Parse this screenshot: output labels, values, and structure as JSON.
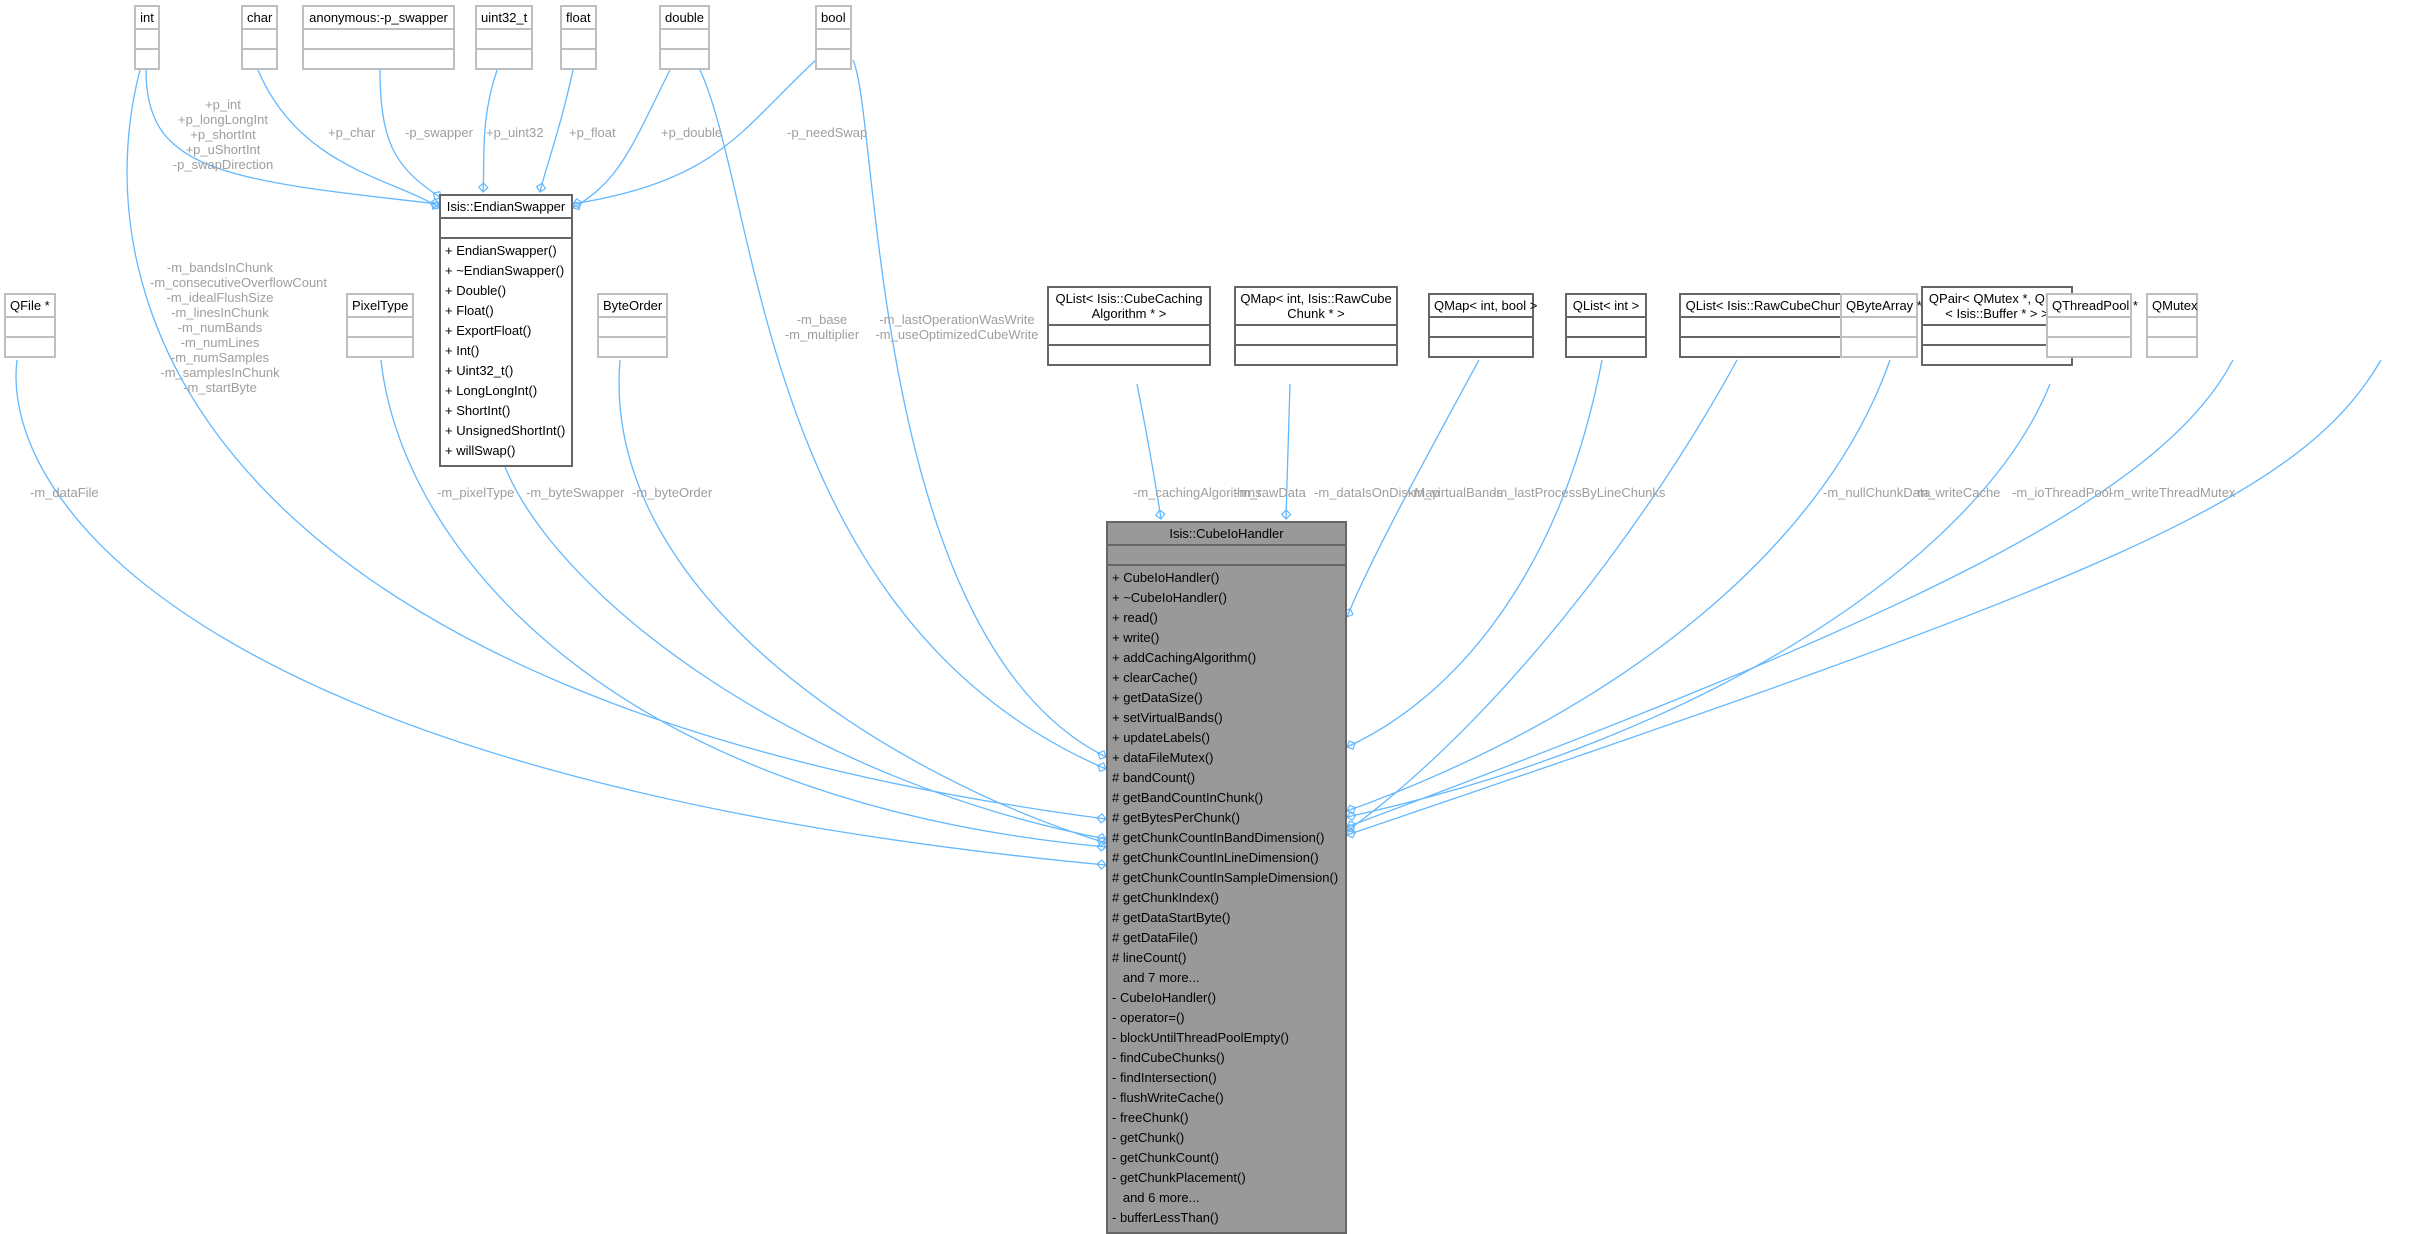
{
  "diagram": {
    "type": "collaboration-diagram",
    "main_class": {
      "name": "Isis::CubeIoHandler",
      "members": [
        "+ CubeIoHandler()",
        "+ ~CubeIoHandler()",
        "+ read()",
        "+ write()",
        "+ addCachingAlgorithm()",
        "+ clearCache()",
        "+ getDataSize()",
        "+ setVirtualBands()",
        "+ updateLabels()",
        "+ dataFileMutex()",
        "# bandCount()",
        "# getBandCountInChunk()",
        "# getBytesPerChunk()",
        "# getChunkCountInBandDimension()",
        "# getChunkCountInLineDimension()",
        "# getChunkCountInSampleDimension()",
        "# getChunkIndex()",
        "# getDataStartByte()",
        "# getDataFile()",
        "# lineCount()",
        "   and 7 more...",
        "- CubeIoHandler()",
        "- operator=()",
        "- blockUntilThreadPoolEmpty()",
        "- findCubeChunks()",
        "- findIntersection()",
        "- flushWriteCache()",
        "- freeChunk()",
        "- getChunk()",
        "- getChunkCount()",
        "- getChunkPlacement()",
        "   and 6 more...",
        "- bufferLessThan()"
      ]
    },
    "endian_swapper": {
      "name": "Isis::EndianSwapper",
      "members": [
        "+ EndianSwapper()",
        "+ ~EndianSwapper()",
        "+ Double()",
        "+ Float()",
        "+ ExportFloat()",
        "+ Int()",
        "+ Uint32_t()",
        "+ LongLongInt()",
        "+ ShortInt()",
        "+ UnsignedShortInt()",
        "+ willSwap()"
      ]
    },
    "nodes": {
      "int": "int",
      "char": "char",
      "anon": "anonymous:-p_swapper",
      "uint32": "uint32_t",
      "float": "float",
      "double": "double",
      "bool": "bool",
      "qfile": "QFile *",
      "pixeltype": "PixelType",
      "byteorder": "ByteOrder",
      "qlist_caching": "QList< Isis::CubeCaching\nAlgorithm * >",
      "qmap_rawcube": "QMap< int, Isis::RawCube\nChunk * >",
      "qmap_intbool": "QMap< int, bool >",
      "qlist_int": "QList< int >",
      "qlist_rawchunk": "QList< Isis::RawCubeChunk * >",
      "qbytearray": "QByteArray *",
      "qpair": "QPair< QMutex *, QList\n< Isis::Buffer * > >",
      "qthreadpool": "QThreadPool *",
      "qmutex": "QMutex"
    },
    "edge_labels": {
      "int_to_swapper": "+p_int\n+p_longLongInt\n+p_shortInt\n+p_uShortInt\n-p_swapDirection",
      "char_to_swapper": "+p_char",
      "anon_to_swapper": "-p_swapper",
      "uint32_to_swapper": "+p_uint32",
      "float_to_swapper": "+p_float",
      "double_to_swapper": "+p_double",
      "bool_to_swapper": "-p_needSwap",
      "int_to_main": "-m_bandsInChunk\n-m_consecutiveOverflowCount\n-m_idealFlushSize\n-m_linesInChunk\n-m_numBands\n-m_numLines\n-m_numSamples\n-m_samplesInChunk\n-m_startByte",
      "qfile_to_main": "-m_dataFile",
      "pixeltype_to_main": "-m_pixelType",
      "swapper_to_main": "-m_byteSwapper",
      "byteorder_to_main": "-m_byteOrder",
      "double_to_main": "-m_base\n-m_multiplier",
      "bool_to_main": "-m_lastOperationWasWrite\n-m_useOptimizedCubeWrite",
      "caching_to_main": "-m_cachingAlgorithms",
      "rawdata_to_main": "-m_rawData",
      "diskmap_to_main": "-m_dataIsOnDiskMap",
      "vbands_to_main": "-m_virtualBands",
      "lastproc_to_main": "-m_lastProcessByLineChunks",
      "nullchunk_to_main": "-m_nullChunkData",
      "writecache_to_main": "-m_writeCache",
      "threadpool_to_main": "-m_ioThreadPool",
      "mutex_to_main": "-m_writeThreadMutex"
    },
    "colors": {
      "edge": "#63b8ff",
      "label": "#9e9e9e",
      "main_fill": "#999999",
      "dark_border": "#666666",
      "light_border": "#bfbfbf"
    }
  }
}
